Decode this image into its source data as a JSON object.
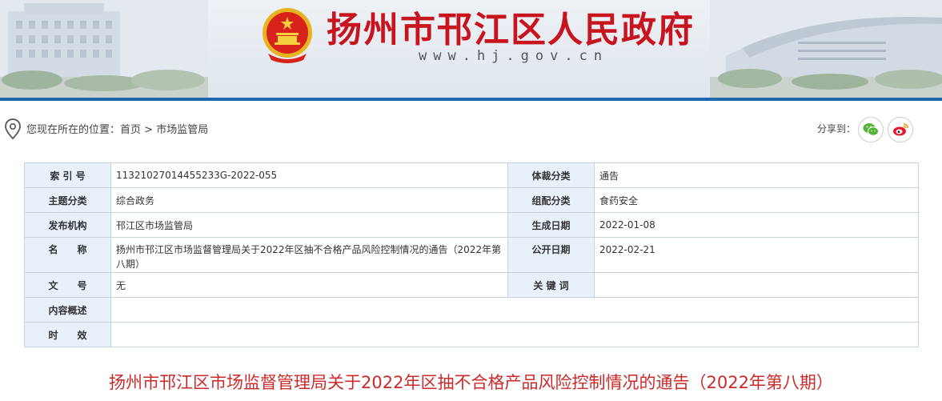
{
  "header": {
    "site_title": "扬州市邗江区人民政府",
    "site_url": "www.hj.gov.cn"
  },
  "breadcrumb": {
    "prefix": "您现在所在的位置：",
    "home": "首页",
    "separator": ">",
    "current": "市场监管局"
  },
  "share": {
    "label": "分享到：",
    "wechat_icon": "wechat-icon",
    "weibo_icon": "weibo-icon"
  },
  "info": {
    "index_no_label": "索 引 号",
    "index_no": "11321027014455233G-2022-055",
    "genre_label": "体裁分类",
    "genre": "通告",
    "topic_label": "主题分类",
    "topic": "综合政务",
    "org_cat_label": "组配分类",
    "org_cat": "食药安全",
    "publisher_label": "发布机构",
    "publisher": "邗江区市场监管局",
    "created_label": "生成日期",
    "created": "2022-01-08",
    "name_label": "名　　称",
    "name": "扬州市邗江区市场监督管理局关于2022年区抽不合格产品风险控制情况的通告（2022年第八期）",
    "published_label": "公开日期",
    "published": "2022-02-21",
    "doc_no_label": "文　　号",
    "doc_no": "无",
    "keywords_label": "关 键 词",
    "keywords": "",
    "summary_label": "内容概述",
    "summary": "",
    "validity_label": "时　　效",
    "validity": ""
  },
  "article": {
    "title": "扬州市邗江区市场监督管理局关于2022年区抽不合格产品风险控制情况的通告（2022年第八期）"
  },
  "colors": {
    "brand_red": "#c8141e",
    "title_red": "#cc2a2a",
    "nav_blue": "#1d68b1",
    "label_bg": "#e8f0fa"
  }
}
